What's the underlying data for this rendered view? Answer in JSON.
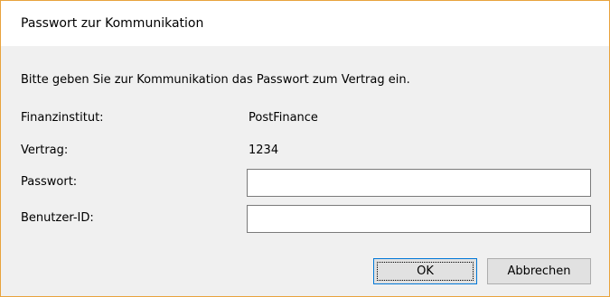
{
  "dialog": {
    "title": "Passwort zur Kommunikation",
    "instruction": "Bitte geben Sie zur Kommunikation das Passwort zum Vertrag ein.",
    "fields": {
      "institution_label": "Finanzinstitut:",
      "institution_value": "PostFinance",
      "contract_label": "Vertrag:",
      "contract_value": "1234",
      "password_label": "Passwort:",
      "password_value": "",
      "userid_label": "Benutzer-ID:",
      "userid_value": ""
    },
    "buttons": {
      "ok_label": "OK",
      "cancel_label": "Abbrechen"
    },
    "colors": {
      "window_border": "#e8a33d",
      "dialog_background": "#f0f0f0",
      "default_button_border": "#0078d7"
    }
  }
}
